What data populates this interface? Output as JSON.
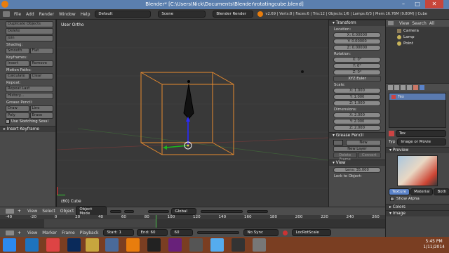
{
  "window": {
    "title": "Blender* [C:\\Users\\Nick\\Documents\\Blender\\rotatingcube.blend]",
    "min": "–",
    "max": "□",
    "close": "✕"
  },
  "info_header": {
    "menus": [
      "File",
      "Add",
      "Render",
      "Window",
      "Help"
    ],
    "screen_layout": "Default",
    "scene": "Scene",
    "engine": "Blender Render",
    "stats": "v2.69 | Verts:8 | Faces:6 | Tris:12 | Objects:1/6 | Lamps:0/3 | Mem:16.76M (9.80M) | Cube"
  },
  "toolshelf": {
    "buttons_top": [
      "Duplicate Objects",
      "Delete",
      "Join"
    ],
    "shading_label": "Shading:",
    "shading": [
      "Smooth",
      "Flat"
    ],
    "keyframes_label": "Keyframes:",
    "keyframes": [
      "Insert",
      "Remove"
    ],
    "motion_label": "Motion Paths:",
    "motion": [
      "Calculate",
      "Clear"
    ],
    "repeat_label": "Repeat:",
    "repeat": [
      "Repeat Last",
      "History..."
    ],
    "grease_label": "Grease Pencil:",
    "grease_row1": [
      "Draw",
      "Line"
    ],
    "grease_row2": [
      "Poly",
      "Erase"
    ],
    "sketching": "Use Sketching Sessi",
    "insert_panel": "Insert Keyframe"
  },
  "viewport": {
    "view_label": "User Ortho",
    "object_label": "(60) Cube"
  },
  "view3d_header": {
    "menus": [
      "View",
      "Select",
      "Object"
    ],
    "mode": "Object Mode",
    "orientation": "Global"
  },
  "timeline": {
    "ticks": [
      "-40",
      "-20",
      "0",
      "20",
      "40",
      "60",
      "80",
      "100",
      "120",
      "140",
      "160",
      "180",
      "200",
      "220",
      "240",
      "260"
    ],
    "menus": [
      "View",
      "Marker",
      "Frame",
      "Playback"
    ],
    "start": "Start: 1",
    "end": "End: 60",
    "current": "60",
    "sync": "No Sync",
    "keying": "LocRotScale"
  },
  "npanel": {
    "transform": "Transform",
    "location_label": "Location:",
    "location": [
      "X: 0.00000",
      "Y: 0.00000",
      "Z: 0.00000"
    ],
    "rotation_label": "Rotation:",
    "rotation": [
      "X: 0°",
      "Y: 0°",
      "Z: 0°"
    ],
    "rotation_mode": "XYZ Euler",
    "scale_label": "Scale:",
    "scale": [
      "X: 1.000",
      "Y: 1.000",
      "Z: 1.000"
    ],
    "dimensions_label": "Dimensions:",
    "dimensions": [
      "X: 2.000",
      "Y: 2.000",
      "Z: 2.000"
    ],
    "grease_pencil": "Grease Pencil",
    "new": "New",
    "new_layer": "New Layer",
    "delete_frame": "Delete Frame",
    "convert": "Convert",
    "view": "View",
    "lens": "Lens: 35.000",
    "lock": "Lock to Object:"
  },
  "outliner": {
    "menus": [
      "View",
      "Search",
      "All"
    ],
    "items": [
      "Camera",
      "Lamp",
      "Point"
    ]
  },
  "properties": {
    "tex_slot": "Tex",
    "tex_name": "Tex",
    "type_label": "Typ",
    "type_value": "Image or Movie",
    "preview_label": "Preview",
    "tabs": [
      "Texture",
      "Material",
      "Both"
    ],
    "show_alpha": "Show Alpha",
    "colors": "Colors",
    "image": "Image"
  },
  "taskbar": {
    "time": "5:45 PM",
    "date": "1/11/2014"
  },
  "colors": {
    "selected_orange": "#e68a2e",
    "grid_line": "#464646",
    "taskbar": "#7a3e22",
    "titlebar": "#5b7fae"
  }
}
